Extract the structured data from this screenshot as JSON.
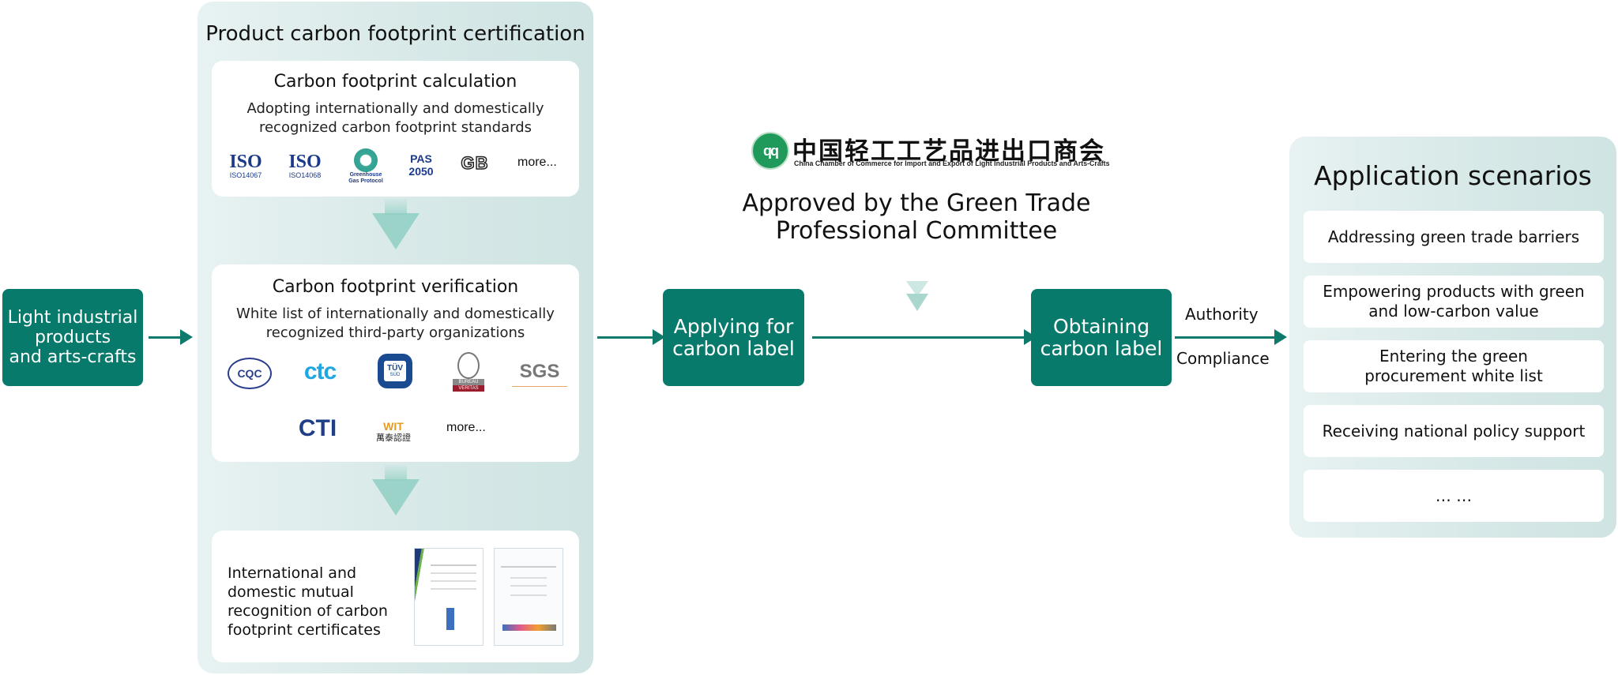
{
  "colors": {
    "accent": "#077a6b",
    "panel_bg": "#dcebea",
    "arrow": "#0e7a6c"
  },
  "input_box": {
    "label_lines": [
      "Light industrial",
      "products",
      "and arts-crafts"
    ]
  },
  "certification": {
    "title": "Product carbon footprint certification",
    "calculation": {
      "title": "Carbon footprint calculation",
      "subtitle_lines": [
        "Adopting internationally and domestically",
        "recognized carbon footprint standards"
      ],
      "logos": [
        {
          "name": "iso-14067-logo",
          "text": "ISO",
          "caption": "ISO14067"
        },
        {
          "name": "iso-14068-logo",
          "text": "ISO",
          "caption": "ISO14068"
        },
        {
          "name": "greenhouse-gas-protocol-logo",
          "text": "",
          "caption": "Greenhouse Gas Protocol"
        },
        {
          "name": "pas-2050-logo",
          "text": "PAS 2050",
          "caption": ""
        },
        {
          "name": "gb-logo",
          "text": "GB",
          "caption": ""
        }
      ],
      "more": "more..."
    },
    "verification": {
      "title": "Carbon footprint verification",
      "subtitle_lines": [
        "White list of internationally and domestically",
        "recognized third-party organizations"
      ],
      "logos": [
        {
          "name": "cqc-logo",
          "text": "CQC"
        },
        {
          "name": "ctc-logo",
          "text": "ctc"
        },
        {
          "name": "tuv-sud-logo",
          "text": "TÜV",
          "sub": "SÜD"
        },
        {
          "name": "bureau-veritas-logo",
          "text": "BUREAU",
          "sub": "VERITAS"
        },
        {
          "name": "sgs-logo",
          "text": "SGS"
        },
        {
          "name": "cti-logo",
          "text": "CTI"
        },
        {
          "name": "wit-logo",
          "text": "WIT",
          "sub": "萬泰認證"
        }
      ],
      "more": "more..."
    },
    "recognition": {
      "text_lines": [
        "International and",
        "domestic mutual",
        "recognition of carbon",
        "footprint certificates"
      ],
      "certificates": [
        "cti-certificate",
        "sgs-certificate"
      ]
    }
  },
  "applying_box": {
    "label_lines": [
      "Applying for",
      "carbon label"
    ]
  },
  "chamber": {
    "name_cn": "中国轻工工艺品进出口商会",
    "name_en": "China Chamber of Commerce for Import and Export of Light Industrial Products and Arts-Crafts",
    "approval_lines": [
      "Approved by the Green Trade",
      "Professional Committee"
    ]
  },
  "obtaining_box": {
    "label_lines": [
      "Obtaining",
      "carbon label"
    ]
  },
  "edge_labels": {
    "top": "Authority",
    "bottom": "Compliance"
  },
  "scenarios": {
    "title": "Application scenarios",
    "items": [
      {
        "lines": [
          "Addressing green trade barriers"
        ]
      },
      {
        "lines": [
          "Empowering products with green",
          "and low-carbon value"
        ]
      },
      {
        "lines": [
          "Entering the green",
          "procurement white list"
        ]
      },
      {
        "lines": [
          "Receiving national policy support"
        ]
      },
      {
        "lines": [
          "… …"
        ]
      }
    ]
  }
}
